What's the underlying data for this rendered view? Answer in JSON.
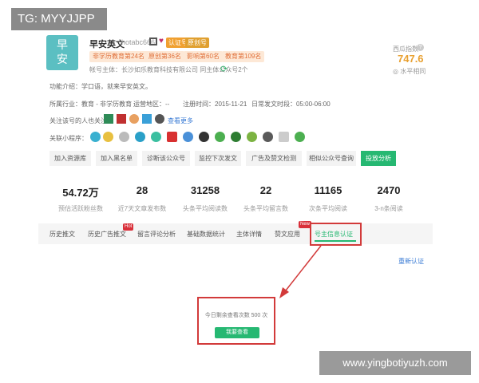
{
  "overlay": {
    "tg_label": "TG: MYYJJPP",
    "watermark": "www.yingbotiyuzh.com"
  },
  "account": {
    "logo_top": "早",
    "logo_bottom": "安",
    "name": "早安英文",
    "id": "hotabc666",
    "badge_verified": "认证号",
    "badge_service": "原创号",
    "ranks": [
      "非学历教育第24名",
      "原创第36名",
      "影响第60名",
      "教育第109名"
    ],
    "subject": "帐号主体：长沙如乐教育科技有限公司 同主体公众号2个",
    "index_label": "西瓜指数",
    "index_value": "747.6",
    "index_trend": "水平相同"
  },
  "info": {
    "intro": "功能介绍：学口语，就来早安英文。",
    "industry": "所属行业：教育 - 非学历教育",
    "region": "运营地区：--",
    "register": "注册时间：2015-11-21",
    "publish_time": "日常发文时段：05:00-06:00",
    "related_people": "关注该号的人也关注：",
    "view_more": "查看更多",
    "mini_programs": "关联小程序："
  },
  "actions": [
    "加入资源库",
    "加入黑名单",
    "诊断该公众号",
    "监控下次发文",
    "广告及赞文检测",
    "相似公众号查询",
    "投放分析"
  ],
  "stats": [
    {
      "value": "54.72万",
      "label": "预估活跃粉丝数"
    },
    {
      "value": "28",
      "label": "近7天文章发布数"
    },
    {
      "value": "31258",
      "label": "头条平均阅读数"
    },
    {
      "value": "22",
      "label": "头条平均留言数"
    },
    {
      "value": "11165",
      "label": "次条平均阅读"
    },
    {
      "value": "2470",
      "label": "3-n条阅读"
    }
  ],
  "tabs": [
    "历史推文",
    "历史广告推文",
    "留言评论分析",
    "基础数据统计",
    "主体详情",
    "赞文应用",
    "号主信息认证"
  ],
  "tab_badges": {
    "hot": "Hot",
    "new": "New"
  },
  "reauth": "重新认证",
  "quota": {
    "text": "今日剩余查看次数 500 次",
    "button": "我要查看"
  }
}
